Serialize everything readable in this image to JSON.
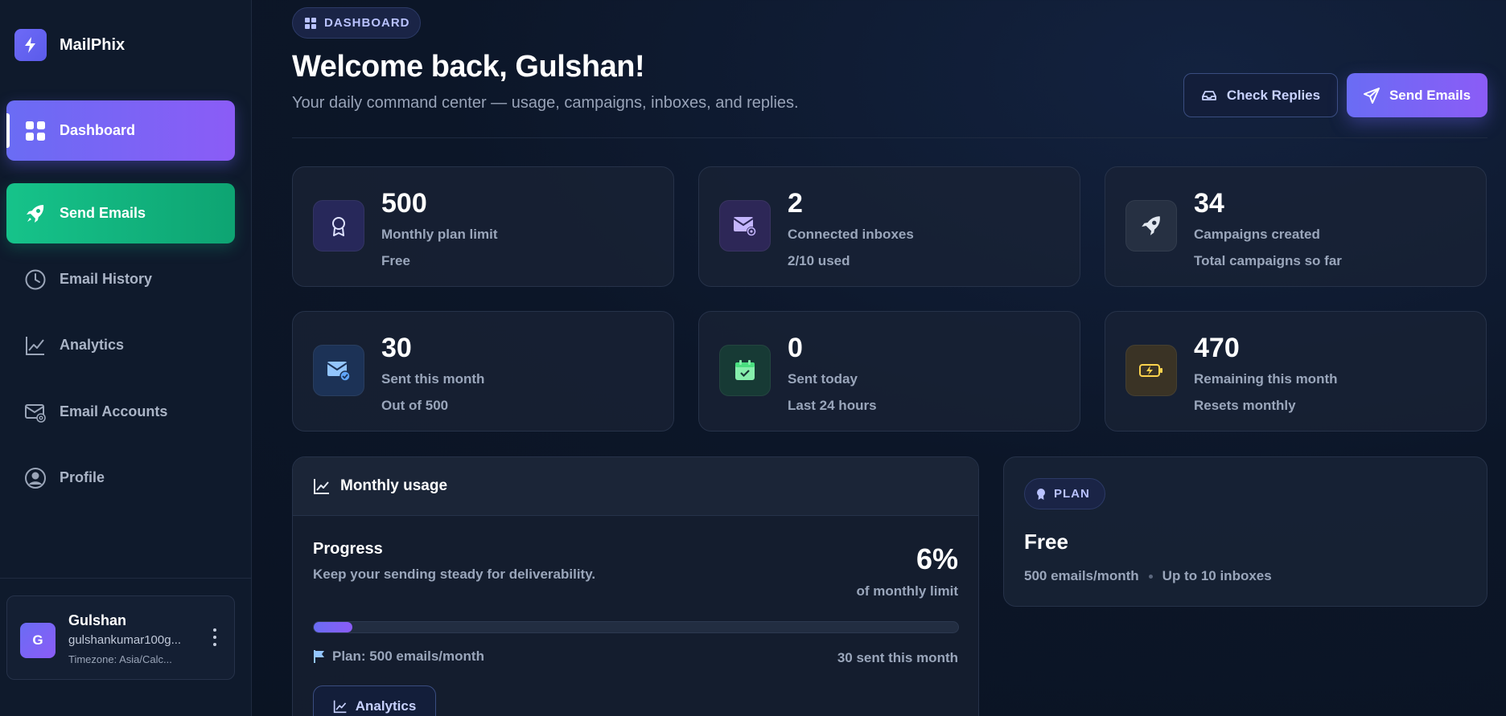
{
  "app": {
    "name": "MailPhix"
  },
  "sidebar": {
    "items": [
      {
        "label": "Dashboard",
        "icon": "grid-icon"
      },
      {
        "label": "Send Emails",
        "icon": "rocket-icon"
      },
      {
        "label": "Email History",
        "icon": "clock-icon"
      },
      {
        "label": "Analytics",
        "icon": "chart-icon"
      },
      {
        "label": "Email Accounts",
        "icon": "mail-at-icon"
      },
      {
        "label": "Profile",
        "icon": "user-circle-icon"
      }
    ],
    "user": {
      "initial": "G",
      "name": "Gulshan",
      "email": "gulshankumar100g...",
      "timezone": "Timezone: Asia/Calc..."
    }
  },
  "header": {
    "badge": "DASHBOARD",
    "title": "Welcome back, Gulshan!",
    "subtitle": "Your daily command center — usage, campaigns, inboxes, and replies.",
    "check_replies": "Check Replies",
    "send_emails": "Send Emails"
  },
  "stats": [
    {
      "value": "500",
      "label": "Monthly plan limit",
      "sub": "Free",
      "icon": "award-icon",
      "color": "#6b6ef5"
    },
    {
      "value": "2",
      "label": "Connected inboxes",
      "sub": "2/10 used",
      "icon": "mail-at-icon",
      "color": "#a78bfa"
    },
    {
      "value": "34",
      "label": "Campaigns created",
      "sub": "Total campaigns so far",
      "icon": "rocket-icon",
      "color": "#cbd5e1"
    },
    {
      "value": "30",
      "label": "Sent this month",
      "sub": "Out of 500",
      "icon": "mail-check-icon",
      "color": "#60a5fa"
    },
    {
      "value": "0",
      "label": "Sent today",
      "sub": "Last 24 hours",
      "icon": "calendar-check-icon",
      "color": "#4ade80"
    },
    {
      "value": "470",
      "label": "Remaining this month",
      "sub": "Resets monthly",
      "icon": "battery-charging-icon",
      "color": "#facc15"
    }
  ],
  "usage": {
    "title": "Monthly usage",
    "progress_label": "Progress",
    "progress_desc": "Keep your sending steady for deliverability.",
    "percent": "6%",
    "percent_value": 0.06,
    "percent_sub": "of monthly limit",
    "plan_line": "Plan: 500 emails/month",
    "sent_line": "30 sent this month",
    "analytics_button": "Analytics"
  },
  "plan": {
    "badge": "PLAN",
    "name": "Free",
    "emails": "500 emails/month",
    "inboxes": "Up to 10 inboxes"
  }
}
